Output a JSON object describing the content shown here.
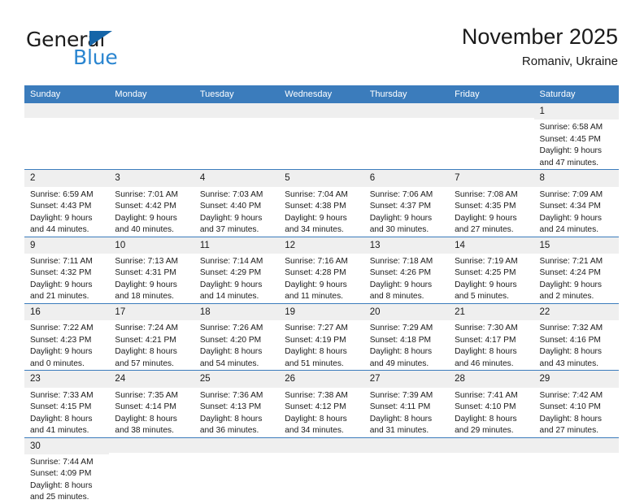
{
  "brand": {
    "name_top": "General",
    "name_bottom": "Blue",
    "accent_color": "#2a85d0",
    "triangle_color": "#1565a8"
  },
  "header": {
    "title": "November 2025",
    "subtitle": "Romaniv, Ukraine"
  },
  "theme": {
    "header_blue": "#3b7cbc",
    "daynum_band": "#efefef",
    "cell_background": "#ffffff",
    "text_color": "#1a1a1a"
  },
  "weekdays": [
    "Sunday",
    "Monday",
    "Tuesday",
    "Wednesday",
    "Thursday",
    "Friday",
    "Saturday"
  ],
  "weeks": [
    [
      {
        "day": "",
        "blank": true
      },
      {
        "day": "",
        "blank": true
      },
      {
        "day": "",
        "blank": true
      },
      {
        "day": "",
        "blank": true
      },
      {
        "day": "",
        "blank": true
      },
      {
        "day": "",
        "blank": true
      },
      {
        "day": "1",
        "sunrise": "Sunrise: 6:58 AM",
        "sunset": "Sunset: 4:45 PM",
        "daylight_1": "Daylight: 9 hours",
        "daylight_2": "and 47 minutes."
      }
    ],
    [
      {
        "day": "2",
        "sunrise": "Sunrise: 6:59 AM",
        "sunset": "Sunset: 4:43 PM",
        "daylight_1": "Daylight: 9 hours",
        "daylight_2": "and 44 minutes."
      },
      {
        "day": "3",
        "sunrise": "Sunrise: 7:01 AM",
        "sunset": "Sunset: 4:42 PM",
        "daylight_1": "Daylight: 9 hours",
        "daylight_2": "and 40 minutes."
      },
      {
        "day": "4",
        "sunrise": "Sunrise: 7:03 AM",
        "sunset": "Sunset: 4:40 PM",
        "daylight_1": "Daylight: 9 hours",
        "daylight_2": "and 37 minutes."
      },
      {
        "day": "5",
        "sunrise": "Sunrise: 7:04 AM",
        "sunset": "Sunset: 4:38 PM",
        "daylight_1": "Daylight: 9 hours",
        "daylight_2": "and 34 minutes."
      },
      {
        "day": "6",
        "sunrise": "Sunrise: 7:06 AM",
        "sunset": "Sunset: 4:37 PM",
        "daylight_1": "Daylight: 9 hours",
        "daylight_2": "and 30 minutes."
      },
      {
        "day": "7",
        "sunrise": "Sunrise: 7:08 AM",
        "sunset": "Sunset: 4:35 PM",
        "daylight_1": "Daylight: 9 hours",
        "daylight_2": "and 27 minutes."
      },
      {
        "day": "8",
        "sunrise": "Sunrise: 7:09 AM",
        "sunset": "Sunset: 4:34 PM",
        "daylight_1": "Daylight: 9 hours",
        "daylight_2": "and 24 minutes."
      }
    ],
    [
      {
        "day": "9",
        "sunrise": "Sunrise: 7:11 AM",
        "sunset": "Sunset: 4:32 PM",
        "daylight_1": "Daylight: 9 hours",
        "daylight_2": "and 21 minutes."
      },
      {
        "day": "10",
        "sunrise": "Sunrise: 7:13 AM",
        "sunset": "Sunset: 4:31 PM",
        "daylight_1": "Daylight: 9 hours",
        "daylight_2": "and 18 minutes."
      },
      {
        "day": "11",
        "sunrise": "Sunrise: 7:14 AM",
        "sunset": "Sunset: 4:29 PM",
        "daylight_1": "Daylight: 9 hours",
        "daylight_2": "and 14 minutes."
      },
      {
        "day": "12",
        "sunrise": "Sunrise: 7:16 AM",
        "sunset": "Sunset: 4:28 PM",
        "daylight_1": "Daylight: 9 hours",
        "daylight_2": "and 11 minutes."
      },
      {
        "day": "13",
        "sunrise": "Sunrise: 7:18 AM",
        "sunset": "Sunset: 4:26 PM",
        "daylight_1": "Daylight: 9 hours",
        "daylight_2": "and 8 minutes."
      },
      {
        "day": "14",
        "sunrise": "Sunrise: 7:19 AM",
        "sunset": "Sunset: 4:25 PM",
        "daylight_1": "Daylight: 9 hours",
        "daylight_2": "and 5 minutes."
      },
      {
        "day": "15",
        "sunrise": "Sunrise: 7:21 AM",
        "sunset": "Sunset: 4:24 PM",
        "daylight_1": "Daylight: 9 hours",
        "daylight_2": "and 2 minutes."
      }
    ],
    [
      {
        "day": "16",
        "sunrise": "Sunrise: 7:22 AM",
        "sunset": "Sunset: 4:23 PM",
        "daylight_1": "Daylight: 9 hours",
        "daylight_2": "and 0 minutes."
      },
      {
        "day": "17",
        "sunrise": "Sunrise: 7:24 AM",
        "sunset": "Sunset: 4:21 PM",
        "daylight_1": "Daylight: 8 hours",
        "daylight_2": "and 57 minutes."
      },
      {
        "day": "18",
        "sunrise": "Sunrise: 7:26 AM",
        "sunset": "Sunset: 4:20 PM",
        "daylight_1": "Daylight: 8 hours",
        "daylight_2": "and 54 minutes."
      },
      {
        "day": "19",
        "sunrise": "Sunrise: 7:27 AM",
        "sunset": "Sunset: 4:19 PM",
        "daylight_1": "Daylight: 8 hours",
        "daylight_2": "and 51 minutes."
      },
      {
        "day": "20",
        "sunrise": "Sunrise: 7:29 AM",
        "sunset": "Sunset: 4:18 PM",
        "daylight_1": "Daylight: 8 hours",
        "daylight_2": "and 49 minutes."
      },
      {
        "day": "21",
        "sunrise": "Sunrise: 7:30 AM",
        "sunset": "Sunset: 4:17 PM",
        "daylight_1": "Daylight: 8 hours",
        "daylight_2": "and 46 minutes."
      },
      {
        "day": "22",
        "sunrise": "Sunrise: 7:32 AM",
        "sunset": "Sunset: 4:16 PM",
        "daylight_1": "Daylight: 8 hours",
        "daylight_2": "and 43 minutes."
      }
    ],
    [
      {
        "day": "23",
        "sunrise": "Sunrise: 7:33 AM",
        "sunset": "Sunset: 4:15 PM",
        "daylight_1": "Daylight: 8 hours",
        "daylight_2": "and 41 minutes."
      },
      {
        "day": "24",
        "sunrise": "Sunrise: 7:35 AM",
        "sunset": "Sunset: 4:14 PM",
        "daylight_1": "Daylight: 8 hours",
        "daylight_2": "and 38 minutes."
      },
      {
        "day": "25",
        "sunrise": "Sunrise: 7:36 AM",
        "sunset": "Sunset: 4:13 PM",
        "daylight_1": "Daylight: 8 hours",
        "daylight_2": "and 36 minutes."
      },
      {
        "day": "26",
        "sunrise": "Sunrise: 7:38 AM",
        "sunset": "Sunset: 4:12 PM",
        "daylight_1": "Daylight: 8 hours",
        "daylight_2": "and 34 minutes."
      },
      {
        "day": "27",
        "sunrise": "Sunrise: 7:39 AM",
        "sunset": "Sunset: 4:11 PM",
        "daylight_1": "Daylight: 8 hours",
        "daylight_2": "and 31 minutes."
      },
      {
        "day": "28",
        "sunrise": "Sunrise: 7:41 AM",
        "sunset": "Sunset: 4:10 PM",
        "daylight_1": "Daylight: 8 hours",
        "daylight_2": "and 29 minutes."
      },
      {
        "day": "29",
        "sunrise": "Sunrise: 7:42 AM",
        "sunset": "Sunset: 4:10 PM",
        "daylight_1": "Daylight: 8 hours",
        "daylight_2": "and 27 minutes."
      }
    ],
    [
      {
        "day": "30",
        "sunrise": "Sunrise: 7:44 AM",
        "sunset": "Sunset: 4:09 PM",
        "daylight_1": "Daylight: 8 hours",
        "daylight_2": "and 25 minutes."
      },
      {
        "day": "",
        "blank": true
      },
      {
        "day": "",
        "blank": true
      },
      {
        "day": "",
        "blank": true
      },
      {
        "day": "",
        "blank": true
      },
      {
        "day": "",
        "blank": true
      },
      {
        "day": "",
        "blank": true
      }
    ]
  ]
}
